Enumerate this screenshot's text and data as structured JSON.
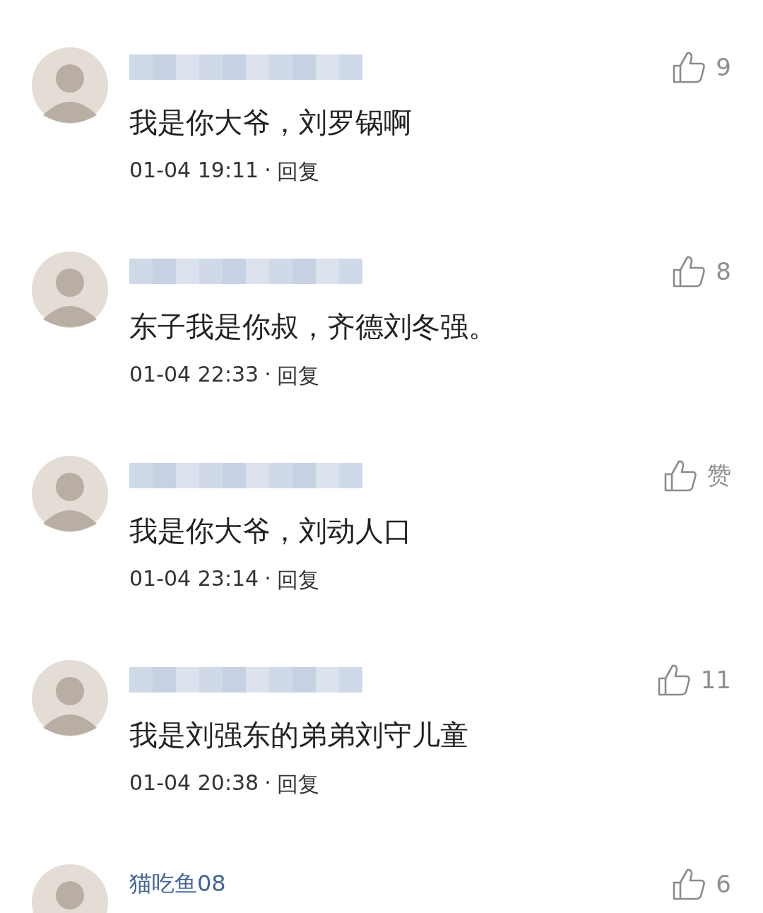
{
  "comments": [
    {
      "name_blurred": true,
      "text": "我是你大爷，刘罗锅啊",
      "time": "01-04 19:11",
      "separator": "·",
      "reply": "回复",
      "likes": "9"
    },
    {
      "name_blurred": true,
      "text": "东子我是你叔，齐德刘冬强。",
      "time": "01-04 22:33",
      "separator": "·",
      "reply": "回复",
      "likes": "8"
    },
    {
      "name_blurred": true,
      "text": "我是你大爷，刘动人口",
      "time": "01-04 23:14",
      "separator": "·",
      "reply": "回复",
      "likes": "赞"
    },
    {
      "name_blurred": true,
      "text": "我是刘强东的弟弟刘守儿童",
      "time": "01-04 20:38",
      "separator": "·",
      "reply": "回复",
      "likes": "11"
    },
    {
      "name": "猫吃鱼08",
      "likes": "6"
    }
  ]
}
